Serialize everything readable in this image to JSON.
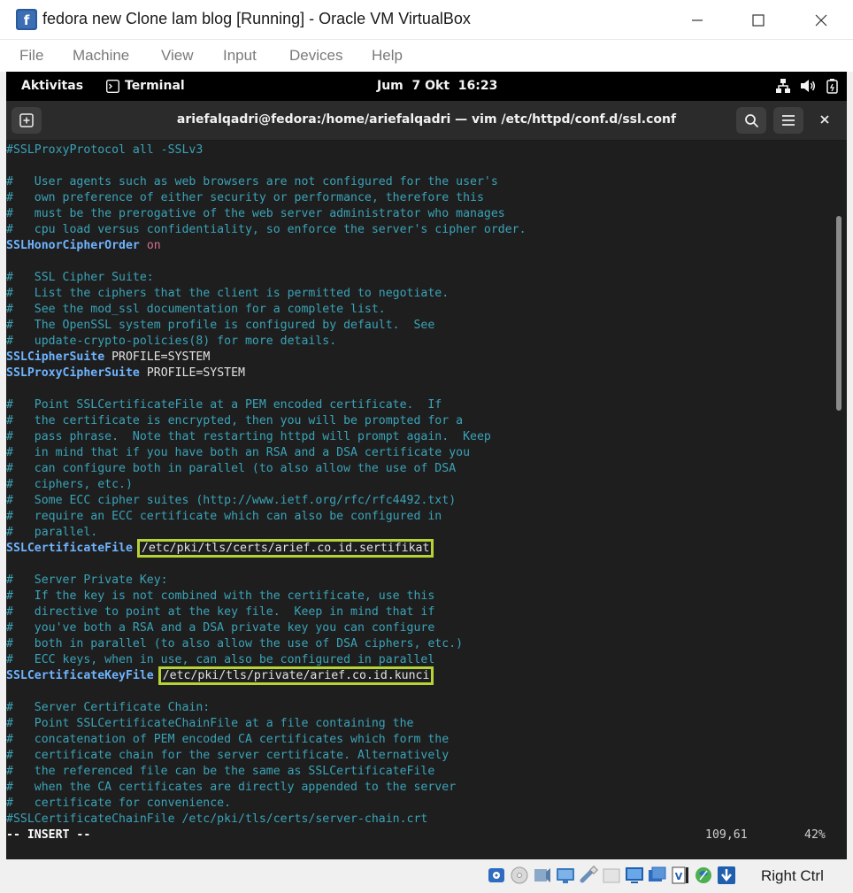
{
  "host_window": {
    "title": "fedora new Clone lam blog [Running] - Oracle VM VirtualBox",
    "menu": [
      "File",
      "Machine",
      "View",
      "Input",
      "Devices",
      "Help"
    ]
  },
  "gnome_topbar": {
    "activities": "Aktivitas",
    "app_name": "Terminal",
    "clock": "Jum  7 Okt  16:23"
  },
  "terminal": {
    "title": "ariefalqadri@fedora:/home/ariefalqadri — vim /etc/httpd/conf.d/ssl.conf",
    "lines": [
      {
        "t": "comment",
        "text": "#SSLProxyProtocol all -SSLv3"
      },
      {
        "t": "blank",
        "text": ""
      },
      {
        "t": "comment",
        "text": "#   User agents such as web browsers are not configured for the user's"
      },
      {
        "t": "comment",
        "text": "#   own preference of either security or performance, therefore this"
      },
      {
        "t": "comment",
        "text": "#   must be the prerogative of the web server administrator who manages"
      },
      {
        "t": "comment",
        "text": "#   cpu load versus confidentiality, so enforce the server's cipher order."
      },
      {
        "t": "directive",
        "key": "SSLHonorCipherOrder",
        "sep": " ",
        "value": "on",
        "vclass": "kw"
      },
      {
        "t": "blank",
        "text": ""
      },
      {
        "t": "comment",
        "text": "#   SSL Cipher Suite:"
      },
      {
        "t": "comment",
        "text": "#   List the ciphers that the client is permitted to negotiate."
      },
      {
        "t": "comment",
        "text": "#   See the mod_ssl documentation for a complete list."
      },
      {
        "t": "comment",
        "text": "#   The OpenSSL system profile is configured by default.  See"
      },
      {
        "t": "comment",
        "text": "#   update-crypto-policies(8) for more details."
      },
      {
        "t": "directive",
        "key": "SSLCipherSuite",
        "sep": " ",
        "value": "PROFILE=SYSTEM",
        "vclass": "val"
      },
      {
        "t": "directive",
        "key": "SSLProxyCipherSuite",
        "sep": " ",
        "value": "PROFILE=SYSTEM",
        "vclass": "val"
      },
      {
        "t": "blank",
        "text": ""
      },
      {
        "t": "comment",
        "text": "#   Point SSLCertificateFile at a PEM encoded certificate.  If"
      },
      {
        "t": "comment",
        "text": "#   the certificate is encrypted, then you will be prompted for a"
      },
      {
        "t": "comment",
        "text": "#   pass phrase.  Note that restarting httpd will prompt again.  Keep"
      },
      {
        "t": "comment",
        "text": "#   in mind that if you have both an RSA and a DSA certificate you"
      },
      {
        "t": "comment",
        "text": "#   can configure both in parallel (to also allow the use of DSA"
      },
      {
        "t": "comment",
        "text": "#   ciphers, etc.)"
      },
      {
        "t": "comment",
        "text": "#   Some ECC cipher suites (http://www.ietf.org/rfc/rfc4492.txt)"
      },
      {
        "t": "comment",
        "text": "#   require an ECC certificate which can also be configured in"
      },
      {
        "t": "comment",
        "text": "#   parallel."
      },
      {
        "t": "directive",
        "key": "SSLCertificateFile",
        "sep": " ",
        "value": "/etc/pki/tls/certs/arief.co.id.sertifikat",
        "vclass": "val",
        "highlight": true
      },
      {
        "t": "blank",
        "text": ""
      },
      {
        "t": "comment",
        "text": "#   Server Private Key:"
      },
      {
        "t": "comment",
        "text": "#   If the key is not combined with the certificate, use this"
      },
      {
        "t": "comment",
        "text": "#   directive to point at the key file.  Keep in mind that if"
      },
      {
        "t": "comment",
        "text": "#   you've both a RSA and a DSA private key you can configure"
      },
      {
        "t": "comment",
        "text": "#   both in parallel (to also allow the use of DSA ciphers, etc.)"
      },
      {
        "t": "comment",
        "text": "#   ECC keys, when in use, can also be configured in parallel"
      },
      {
        "t": "directive",
        "key": "SSLCertificateKeyFile",
        "sep": " ",
        "value": "/etc/pki/tls/private/arief.co.id.kunci",
        "vclass": "val",
        "highlight": true
      },
      {
        "t": "blank",
        "text": ""
      },
      {
        "t": "comment",
        "text": "#   Server Certificate Chain:"
      },
      {
        "t": "comment",
        "text": "#   Point SSLCertificateChainFile at a file containing the"
      },
      {
        "t": "comment",
        "text": "#   concatenation of PEM encoded CA certificates which form the"
      },
      {
        "t": "comment",
        "text": "#   certificate chain for the server certificate. Alternatively"
      },
      {
        "t": "comment",
        "text": "#   the referenced file can be the same as SSLCertificateFile"
      },
      {
        "t": "comment",
        "text": "#   when the CA certificates are directly appended to the server"
      },
      {
        "t": "comment",
        "text": "#   certificate for convenience."
      },
      {
        "t": "comment",
        "text": "#SSLCertificateChainFile /etc/pki/tls/certs/server-chain.crt"
      }
    ],
    "status": {
      "mode": "-- INSERT --",
      "position": "109,61",
      "percent": "42%"
    }
  },
  "statusbar": {
    "host_key": "Right Ctrl",
    "icons": [
      "hard-disk-icon",
      "optical-drive-icon",
      "audio-icon",
      "network-icon",
      "usb-icon",
      "shared-folders-icon",
      "display-icon",
      "recording-icon",
      "cpu-icon",
      "mouse-integration-icon",
      "keyboard-icon"
    ]
  },
  "colors": {
    "comment": "#3aa3b8",
    "directive": "#6fb4ff",
    "keyword": "#d36f8a",
    "highlight_box": "#b5d334",
    "terminal_bg": "#1e1e1e"
  }
}
